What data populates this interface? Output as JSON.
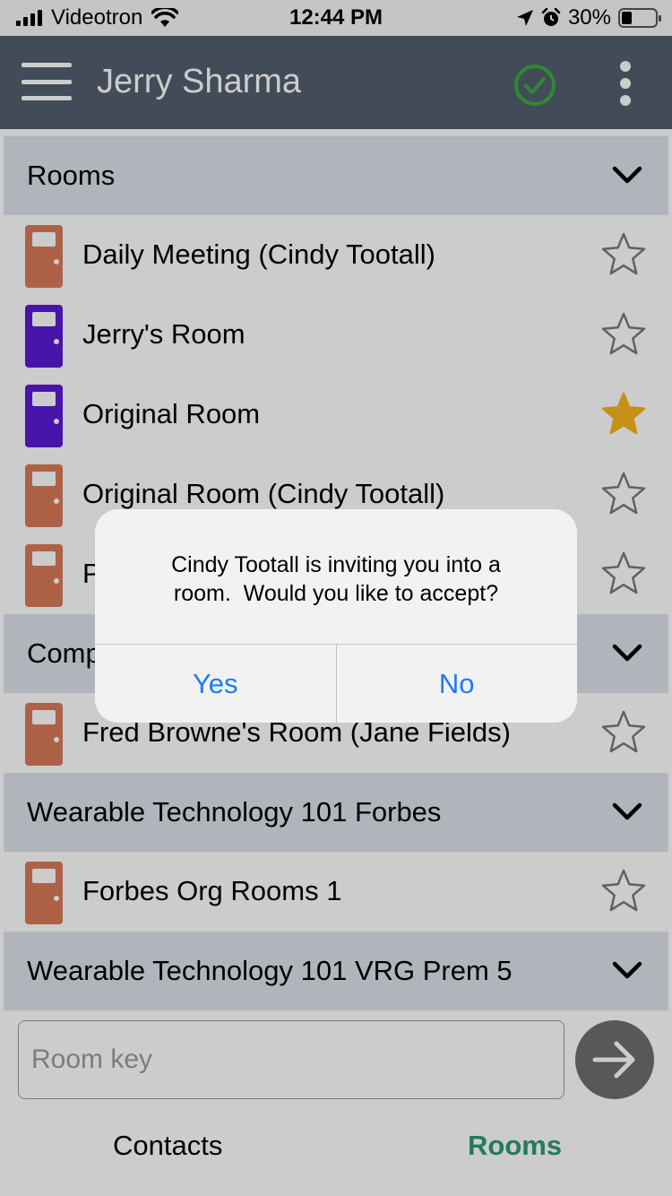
{
  "status_bar": {
    "carrier": "Videotron",
    "time": "12:44 PM",
    "battery": "30%",
    "battery_level": 0.3
  },
  "app_bar": {
    "title": "Jerry Sharma",
    "status_color": "#3cac3c"
  },
  "sections": [
    {
      "title": "Rooms",
      "rooms": [
        {
          "label": "Daily Meeting (Cindy Tootall)",
          "door_color": "#d97b5a",
          "favorite": false
        },
        {
          "label": "Jerry's Room",
          "door_color": "#5a19d4",
          "favorite": false
        },
        {
          "label": "Original Room",
          "door_color": "#5a19d4",
          "favorite": true
        },
        {
          "label": "Original Room (Cindy Tootall)",
          "door_color": "#d97b5a",
          "favorite": false
        },
        {
          "label": "P",
          "door_color": "#d97b5a",
          "favorite": false
        }
      ]
    },
    {
      "title": "Comp",
      "rooms": [
        {
          "label": "Fred Browne's Room (Jane Fields)",
          "door_color": "#d97b5a",
          "favorite": false
        }
      ]
    },
    {
      "title": "Wearable Technology 101 Forbes",
      "rooms": [
        {
          "label": "Forbes Org Rooms 1",
          "door_color": "#d97b5a",
          "favorite": false
        }
      ]
    },
    {
      "title": "Wearable Technology 101 VRG Prem 5",
      "rooms": []
    }
  ],
  "room_key": {
    "placeholder": "Room key",
    "value": ""
  },
  "tabs": {
    "contacts": "Contacts",
    "rooms": "Rooms"
  },
  "dialog": {
    "message": "Cindy Tootall is inviting you into a\nroom.  Would you like to accept?",
    "yes_label": "Yes",
    "no_label": "No"
  },
  "colors": {
    "appbar": "#52606e",
    "section_header": "#dde3ea",
    "star_filled": "#f5b41d",
    "star_outline": "#7a7a7a",
    "accent_tab": "#2e9a71",
    "dialog_button": "#1d7cf2"
  }
}
